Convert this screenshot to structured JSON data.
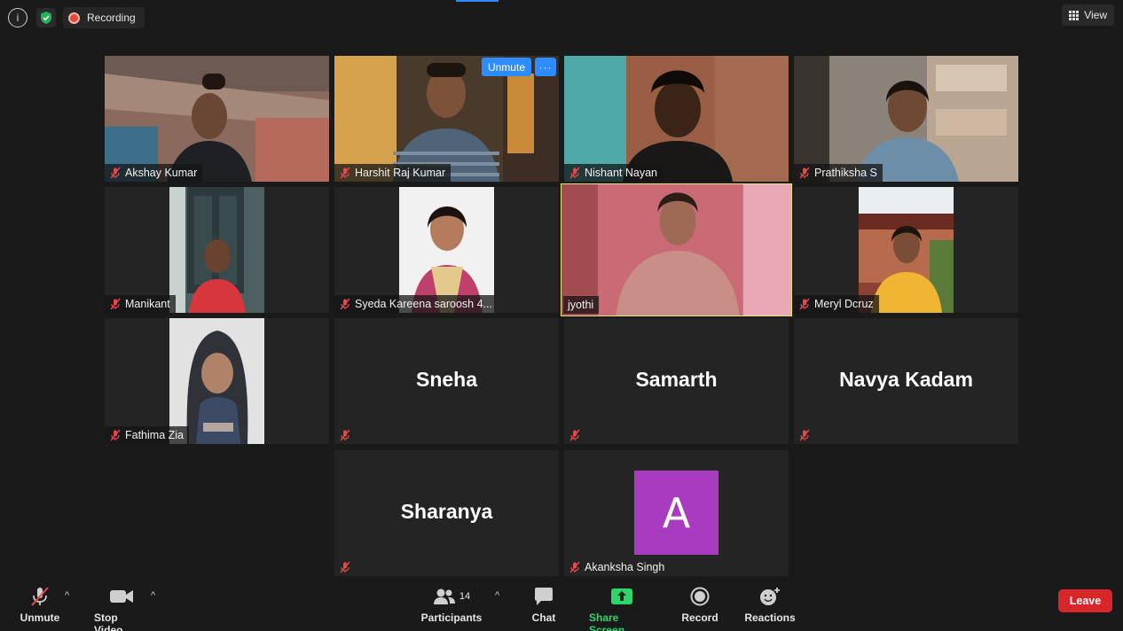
{
  "topbar": {
    "info_glyph": "i",
    "recording_label": "Recording",
    "view_label": "View"
  },
  "tiles": [
    {
      "name": "Akshay Kumar"
    },
    {
      "name": "Harshit Raj Kumar",
      "unmute_label": "Unmute",
      "more_label": "···"
    },
    {
      "name": "Nishant Nayan"
    },
    {
      "name": "Prathiksha S"
    },
    {
      "name": "Manikant"
    },
    {
      "name": "Syeda Kareena saroosh 4..."
    },
    {
      "name": "jyothi"
    },
    {
      "name": "Meryl Dcruz"
    },
    {
      "name": "Fathima Zia"
    },
    {
      "name": "Sneha"
    },
    {
      "name": "Samarth"
    },
    {
      "name": "Navya Kadam"
    },
    {
      "name": "Sharanya"
    },
    {
      "name": "Akanksha Singh",
      "avatar_letter": "A"
    }
  ],
  "toolbar": {
    "unmute": "Unmute",
    "stop_video": "Stop Video",
    "participants": "Participants",
    "participant_count": "14",
    "chat": "Chat",
    "share_screen": "Share Screen",
    "record": "Record",
    "reactions": "Reactions",
    "leave": "Leave",
    "caret": "^"
  },
  "colors": {
    "accent_blue": "#2d8cff",
    "share_green": "#2fd46d",
    "leave_red": "#d8262b",
    "active_speaker": "#e9e47a",
    "avatar_purple": "#a83bbf"
  }
}
